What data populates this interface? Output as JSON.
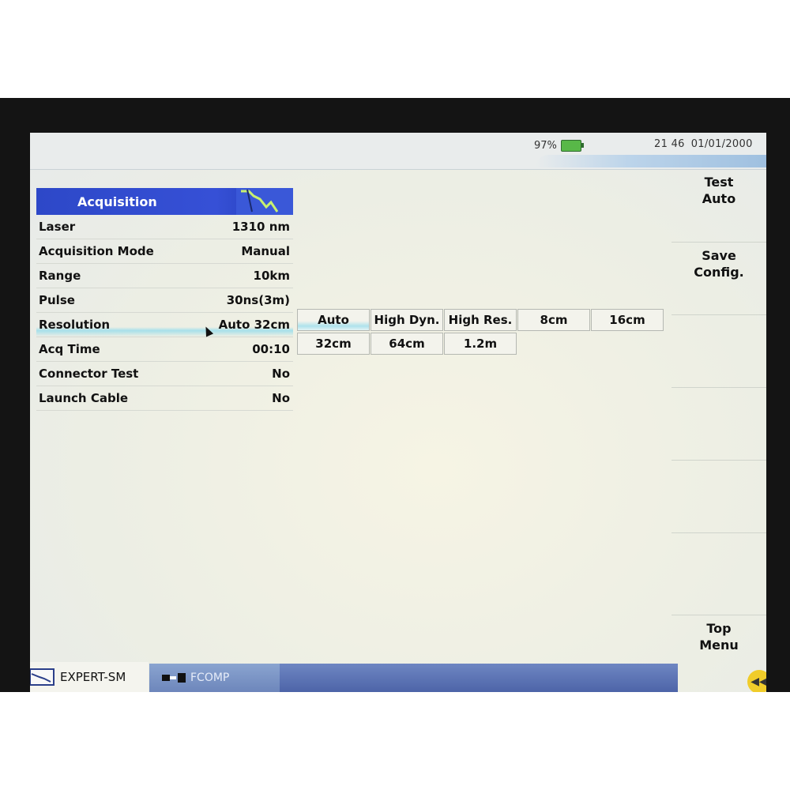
{
  "status": {
    "battery": "97%",
    "time": "21 46",
    "date": "01/01/2000"
  },
  "panel": {
    "title": "Acquisition",
    "rows": [
      {
        "label": "Laser",
        "value": "1310 nm"
      },
      {
        "label": "Acquisition Mode",
        "value": "Manual"
      },
      {
        "label": "Range",
        "value": "10km"
      },
      {
        "label": "Pulse",
        "value": "30ns(3m)"
      },
      {
        "label": "Resolution",
        "value": "Auto 32cm"
      },
      {
        "label": "Acq Time",
        "value": "00:10"
      },
      {
        "label": "Connector Test",
        "value": "No"
      },
      {
        "label": "Launch Cable",
        "value": "No"
      }
    ]
  },
  "resolution_options": [
    "Auto",
    "High Dyn.",
    "High Res.",
    "8cm",
    "16cm",
    "32cm",
    "64cm",
    "1.2m"
  ],
  "softkeys": {
    "test": {
      "line1": "Test",
      "line2": "Auto"
    },
    "save": {
      "line1": "Save",
      "line2": "Config."
    },
    "top": {
      "line1": "Top",
      "line2": "Menu"
    }
  },
  "taskbar": {
    "expert": "EXPERT-SM",
    "fcomp": "FCOMP"
  },
  "colors": {
    "header_blue": "#2d48c8",
    "selection_cyan": "#a6e0ea",
    "battery_green": "#58b848"
  }
}
